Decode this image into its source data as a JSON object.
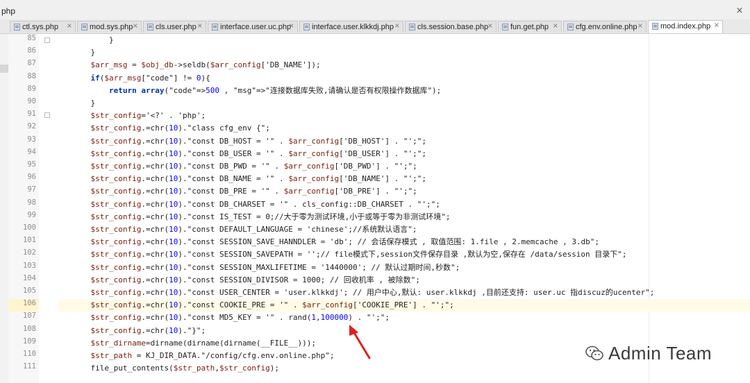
{
  "window": {
    "title": "php",
    "close_glyph": "×"
  },
  "tabs": [
    {
      "label": "ctl.sys.php",
      "active": false
    },
    {
      "label": "mod.sys.php",
      "active": false
    },
    {
      "label": "cls.user.php",
      "active": false
    },
    {
      "label": "interface.user.uc.php",
      "active": false
    },
    {
      "label": "interface.user.klkkdj.php",
      "active": false
    },
    {
      "label": "cls.session.base.php",
      "active": false
    },
    {
      "label": "fun.get.php",
      "active": false
    },
    {
      "label": "cfg.env.online.php",
      "active": false
    },
    {
      "label": "mod.index.php",
      "active": true
    }
  ],
  "tab_close_glyph": "×",
  "editor": {
    "highlighted_line": 106,
    "lines": [
      {
        "num": "85",
        "html": "        }"
      },
      {
        "num": "86",
        "html": "    }"
      },
      {
        "num": "87",
        "html": "    <span class=\"v\">$arr_msg</span> = <span class=\"v\">$obj_db</span>-&gt;seldb(<span class=\"v\">$arr_config</span>['DB_NAME']);"
      },
      {
        "num": "88",
        "html": "    <span class=\"k\">if</span>(<span class=\"v\">$arr_msg</span>[\"code\"] != <span class=\"n\">0</span>){"
      },
      {
        "num": "89",
        "html": "        <span class=\"k\">return</span> <span class=\"k\">array</span>(\"code\"=&gt;<span class=\"n\">500</span> , \"msg\"=&gt;\"连接数据库失败,请确认是否有权限操作数据库\");"
      },
      {
        "num": "90",
        "html": "    }"
      },
      {
        "num": "91",
        "html": "    <span class=\"v\">$str_config</span>='&lt;?' . 'php';"
      },
      {
        "num": "92",
        "html": "    <span class=\"v\">$str_config</span>.=chr(<span class=\"n\">10</span>).\"class cfg_env {\";"
      },
      {
        "num": "93",
        "html": "    <span class=\"v\">$str_config</span>.=chr(<span class=\"n\">10</span>).\"const DB_HOST = '\" . <span class=\"v\">$arr_config</span>['DB_HOST'] . \"';\";"
      },
      {
        "num": "94",
        "html": "    <span class=\"v\">$str_config</span>.=chr(<span class=\"n\">10</span>).\"const DB_USER = '\" . <span class=\"v\">$arr_config</span>['DB_USER'] . \"';\";"
      },
      {
        "num": "95",
        "html": "    <span class=\"v\">$str_config</span>.=chr(<span class=\"n\">10</span>).\"const DB_PWD = '\" . <span class=\"v\">$arr_config</span>['DB_PWD'] . \"';\";"
      },
      {
        "num": "96",
        "html": "    <span class=\"v\">$str_config</span>.=chr(<span class=\"n\">10</span>).\"const DB_NAME = '\" . <span class=\"v\">$arr_config</span>['DB_NAME'] . \"';\";"
      },
      {
        "num": "97",
        "html": "    <span class=\"v\">$str_config</span>.=chr(<span class=\"n\">10</span>).\"const DB_PRE = '\" . <span class=\"v\">$arr_config</span>['DB_PRE'] . \"';\";"
      },
      {
        "num": "98",
        "html": "    <span class=\"v\">$str_config</span>.=chr(<span class=\"n\">10</span>).\"const DB_CHARSET = '\" . cls_config::DB_CHARSET . \"';\";"
      },
      {
        "num": "99",
        "html": "    <span class=\"v\">$str_config</span>.=chr(<span class=\"n\">10</span>).\"const IS_TEST = 0;//大于零为测试环境,小于或等于零为非测试环境\";"
      },
      {
        "num": "100",
        "html": "    <span class=\"v\">$str_config</span>.=chr(<span class=\"n\">10</span>).\"const DEFAULT_LANGUAGE = 'chinese';//系统默认语言\";"
      },
      {
        "num": "101",
        "html": "    <span class=\"v\">$str_config</span>.=chr(<span class=\"n\">10</span>).\"const SESSION_SAVE_HANNDLER = 'db'; // 会话保存模式 , 取值范围: 1.file , 2.memcache , 3.db\";"
      },
      {
        "num": "102",
        "html": "    <span class=\"v\">$str_config</span>.=chr(<span class=\"n\">10</span>).\"const SESSION_SAVEPATH = '';// file模式下,session文件保存目录 ,默认为空,保存在 /data/session 目录下\";"
      },
      {
        "num": "103",
        "html": "    <span class=\"v\">$str_config</span>.=chr(<span class=\"n\">10</span>).\"const SESSION_MAXLIFETIME = '1440000'; // 默认过期时间,秒数\";"
      },
      {
        "num": "104",
        "html": "    <span class=\"v\">$str_config</span>.=chr(<span class=\"n\">10</span>).\"const SESSION_DIVISOR = 1000; // 回收机率 , 被除数\";"
      },
      {
        "num": "105",
        "html": "    <span class=\"v\">$str_config</span>.=chr(<span class=\"n\">10</span>).\"const USER_CENTER = 'user.klkkdj'; // 用户中心,默认: user.klkkdj ,目前还支持: user.uc 指discuz的ucenter\";"
      },
      {
        "num": "106",
        "html": "    <span class=\"v\">$str_config</span>.=chr(<span class=\"n\">10</span>).\"const COOKIE_PRE = '\" . <span class=\"v\">$arr_config</span>['COOKIE_PRE'] . \"';\";"
      },
      {
        "num": "107",
        "html": "    <span class=\"v\">$str_config</span>.=chr(<span class=\"n\">10</span>).\"const MD5_KEY = '\" . rand(<span class=\"n\">1</span>,<span class=\"n\">100000</span>) . \"';\";"
      },
      {
        "num": "108",
        "html": "    <span class=\"v\">$str_config</span>.=chr(<span class=\"n\">10</span>).\"}\";"
      },
      {
        "num": "109",
        "html": "    <span class=\"v\">$str_dirname</span>=dirname(dirname(dirname(__FILE__)));"
      },
      {
        "num": "110",
        "html": "    <span class=\"v\">$str_path</span> = KJ_DIR_DATA.\"/config/cfg.env.online.php\";"
      },
      {
        "num": "111",
        "html": "    file_put_contents(<span class=\"v\">$str_path</span>,<span class=\"v\">$str_config</span>);"
      }
    ]
  },
  "annotation": {
    "color": "#e02020"
  },
  "watermark": {
    "text": "Admin Team",
    "icon": "wechat-icon"
  }
}
